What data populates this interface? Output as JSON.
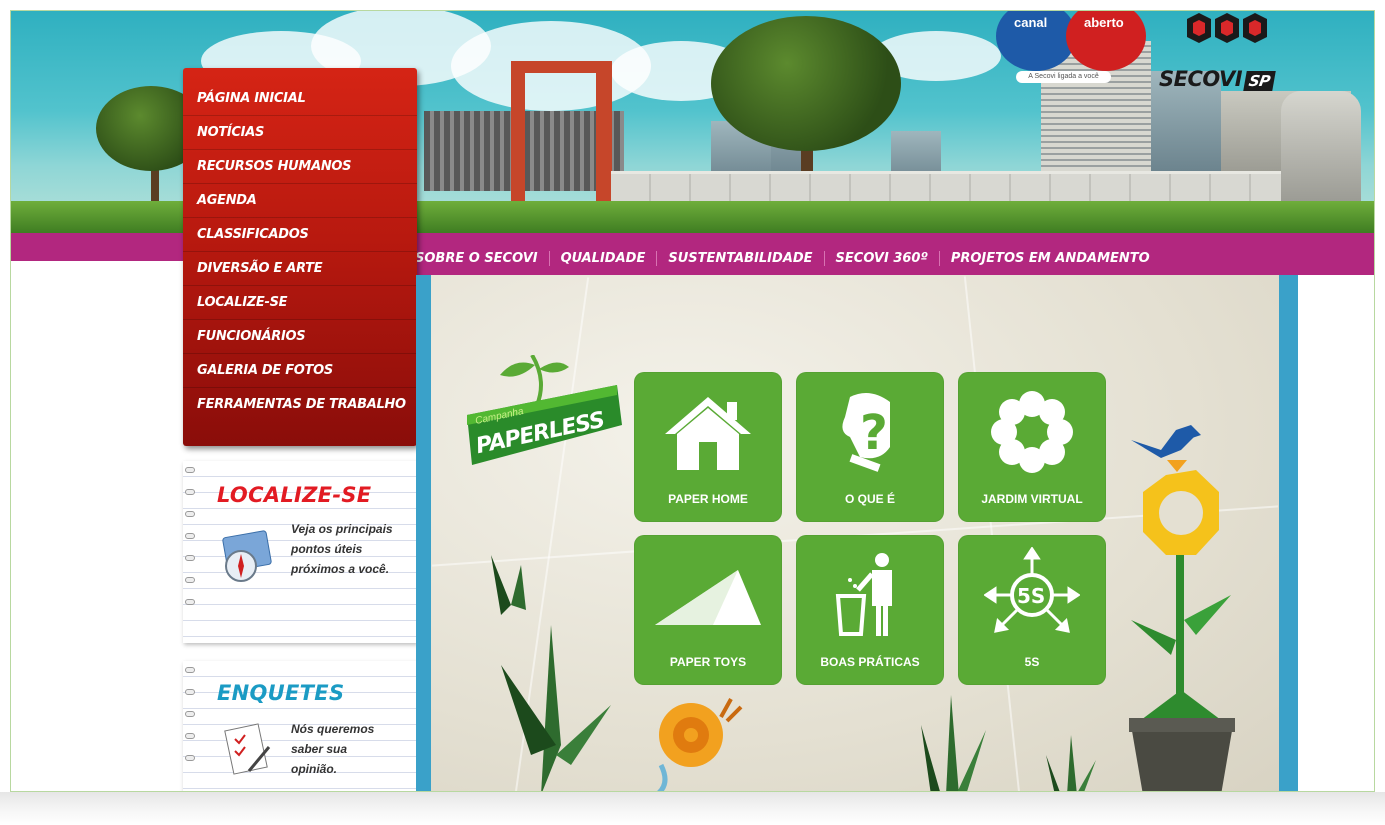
{
  "header": {
    "canal_left": "canal",
    "canal_right": "aberto",
    "canal_tagline": "A Secovi ligada a você",
    "brand": "SECOVI",
    "brand_suffix": "SP"
  },
  "left_menu": [
    {
      "label": "PÁGINA INICIAL"
    },
    {
      "label": "NOTÍCIAS"
    },
    {
      "label": "RECURSOS HUMANOS"
    },
    {
      "label": "AGENDA"
    },
    {
      "label": "CLASSIFICADOS"
    },
    {
      "label": "DIVERSÃO E ARTE"
    },
    {
      "label": "LOCALIZE-SE"
    },
    {
      "label": "FUNCIONÁRIOS"
    },
    {
      "label": "GALERIA DE FOTOS"
    },
    {
      "label": "FERRAMENTAS DE TRABALHO"
    }
  ],
  "top_nav": [
    {
      "label": "SOBRE O SECOVI"
    },
    {
      "label": "QUALIDADE"
    },
    {
      "label": "SUSTENTABILIDADE"
    },
    {
      "label": "SECOVI 360º"
    },
    {
      "label": "PROJETOS EM ANDAMENTO"
    }
  ],
  "localize_widget": {
    "title": "LOCALIZE-SE",
    "title_color": "#e21b23",
    "text": "Veja os principais pontos úteis próximos a você."
  },
  "enquetes_widget": {
    "title": "ENQUETES",
    "title_color": "#1b9bc4",
    "text": "Nós queremos saber sua opinião."
  },
  "campaign": {
    "small": "Campanha",
    "big": "PAPERLESS"
  },
  "tiles": [
    {
      "label": "PAPER HOME",
      "icon": "house-icon"
    },
    {
      "label": "O QUE É",
      "icon": "question-head-icon"
    },
    {
      "label": "JARDIM VIRTUAL",
      "icon": "flower-icon"
    },
    {
      "label": "PAPER TOYS",
      "icon": "paper-triangle-icon"
    },
    {
      "label": "BOAS PRÁTICAS",
      "icon": "trash-person-icon"
    },
    {
      "label": "5S",
      "icon": "5s-arrows-icon"
    }
  ],
  "colors": {
    "menu_red": "#c21d10",
    "nav_magenta": "#b2277f",
    "tile_green": "#5aaa35",
    "content_blue": "#3aa1c9"
  }
}
